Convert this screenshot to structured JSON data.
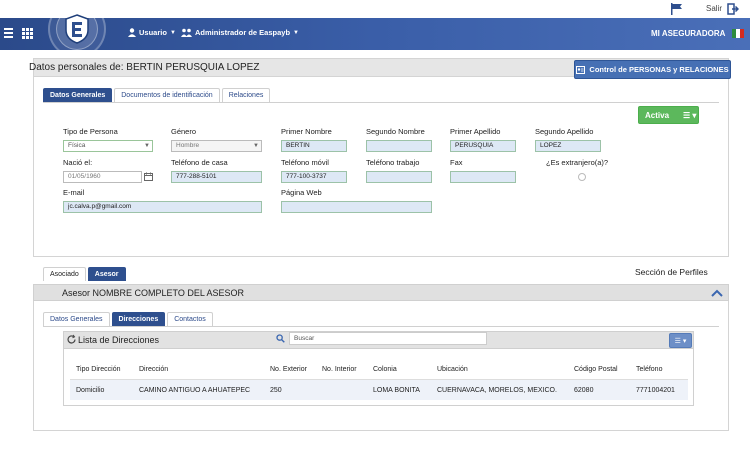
{
  "topbar": {
    "salir_label": "Salir"
  },
  "navbar": {
    "usuario_label": "Usuario",
    "admin_label": "Administrador de Easpayb",
    "brand_label": "MI ASEGURADORA"
  },
  "persona": {
    "title": "Datos personales de: BERTIN PERUSQUIA LOPEZ",
    "control_button": "Control de PERSONAS y RELACIONES",
    "tabs": [
      "Datos Generales",
      "Documentos de identificación",
      "Relaciones"
    ],
    "status_button": "Activa",
    "fields": {
      "tipo_persona_label": "Tipo de Persona",
      "tipo_persona_value": "Física",
      "genero_label": "Género",
      "genero_value": "Hombre",
      "primer_nombre_label": "Primer Nombre",
      "primer_nombre_value": "BERTIN",
      "segundo_nombre_label": "Segundo Nombre",
      "segundo_nombre_value": "",
      "primer_apellido_label": "Primer Apellido",
      "primer_apellido_value": "PERUSQUIA",
      "segundo_apellido_label": "Segundo Apellido",
      "segundo_apellido_value": "LOPEZ",
      "nacio_label": "Nació el:",
      "nacio_value": "01/05/1960",
      "tel_casa_label": "Teléfono de casa",
      "tel_casa_value": "777-288-5101",
      "tel_movil_label": "Teléfono móvil",
      "tel_movil_value": "777-100-3737",
      "tel_trabajo_label": "Teléfono trabajo",
      "tel_trabajo_value": "",
      "fax_label": "Fax",
      "fax_value": "",
      "extranjero_label": "¿Es extranjero(a)?",
      "email_label": "E-mail",
      "email_value": "jc.calva.p@gmail.com",
      "web_label": "Página Web",
      "web_value": ""
    }
  },
  "perfiles": {
    "tabs": [
      "Asociado",
      "Asesor"
    ],
    "section_label": "Sección de Perfiles",
    "asesor_title": "Asesor NOMBRE COMPLETO DEL ASESOR",
    "asesor_tabs": [
      "Datos Generales",
      "Direcciones",
      "Contactos"
    ]
  },
  "direcciones": {
    "title": "Lista de Direcciones",
    "search_placeholder": "Buscar",
    "columns": [
      "Tipo Dirección",
      "Dirección",
      "No. Exterior",
      "No. Interior",
      "Colonia",
      "Ubicación",
      "Código Postal",
      "Teléfono"
    ],
    "rows": [
      [
        "Domicilio",
        "CAMINO ANTIGUO A AHUATEPEC",
        "250",
        "",
        "LOMA BONITA",
        "CUERNAVACA, MORELOS, MEXICO.",
        "62080",
        "7771004201"
      ]
    ]
  },
  "colors": {
    "navbar": "#3a5ea8",
    "active_tab": "#2e4f8e",
    "status_green": "#5cb85c",
    "field_fill": "#dde8f5"
  }
}
